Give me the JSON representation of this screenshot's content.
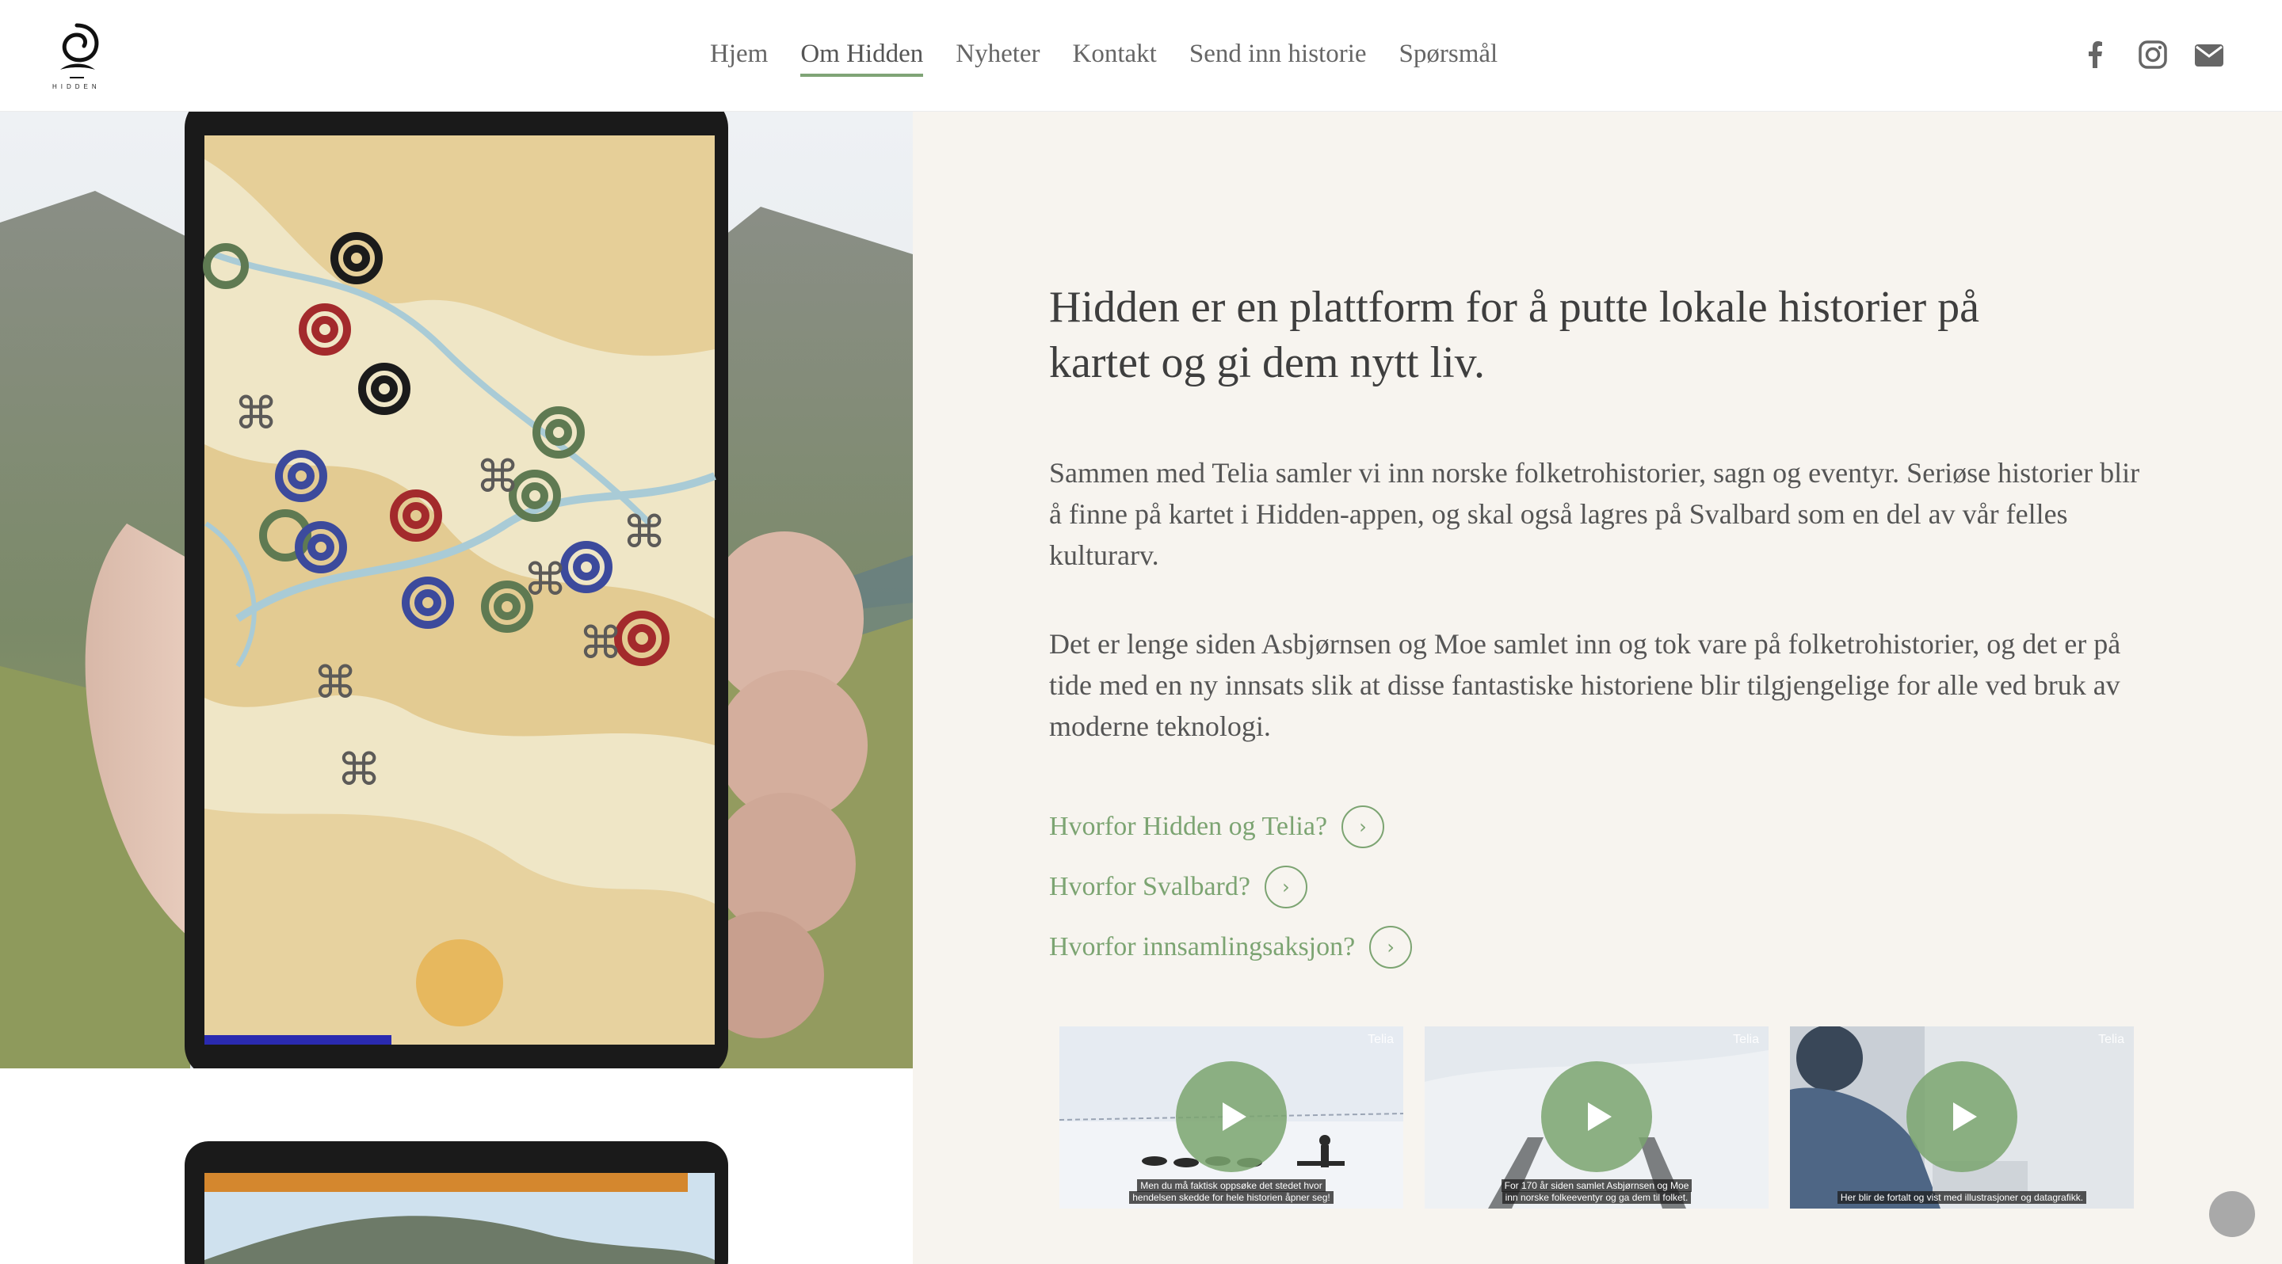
{
  "brand": {
    "logo_text": "HIDDEN"
  },
  "nav": {
    "items": [
      {
        "label": "Hjem",
        "active": false
      },
      {
        "label": "Om Hidden",
        "active": true
      },
      {
        "label": "Nyheter",
        "active": false
      },
      {
        "label": "Kontakt",
        "active": false
      },
      {
        "label": "Send inn historie",
        "active": false
      },
      {
        "label": "Spørsmål",
        "active": false
      }
    ],
    "accent": "#7fa476"
  },
  "social": {
    "icons": [
      "facebook-icon",
      "instagram-icon",
      "email-icon"
    ]
  },
  "main": {
    "headline": "Hidden er en plattform for å putte lokale historier på kartet og gi dem nytt liv.",
    "paragraph_1": "Sammen med Telia samler vi inn norske folketrohistorier, sagn og eventyr. Seriøse historier blir å finne på kartet i Hidden-appen, og skal også lagres på Svalbard som en del av vår felles kulturarv.",
    "paragraph_2": "Det er lenge siden Asbjørnsen og Moe samlet inn og tok vare på folketrohistorier, og det er på tide med en ny innsats slik at disse fantastiske historiene blir tilgjengelige for alle ved bruk av moderne teknologi.",
    "links": [
      {
        "label": "Hvorfor Hidden og Telia?"
      },
      {
        "label": "Hvorfor Svalbard?"
      },
      {
        "label": "Hvorfor innsamlingsaksjon?"
      }
    ],
    "videos": [
      {
        "caption_1": "Men du må faktisk oppsøke det stedet hvor",
        "caption_2": "hendelsen skedde for hele historien åpner seg!",
        "brand": "Telia"
      },
      {
        "caption_1": "For 170 år siden samlet Asbjørnsen og Moe",
        "caption_2": "inn norske folkeeventyr og ga dem til folket.",
        "brand": "Telia"
      },
      {
        "caption_1": "Her blir de fortalt og vist med illustrasjoner og datagrafikk.",
        "caption_2": "",
        "brand": "Telia"
      }
    ]
  },
  "colors": {
    "link": "#7ca472",
    "content_bg": "#f7f4ef",
    "text": "#555555"
  }
}
